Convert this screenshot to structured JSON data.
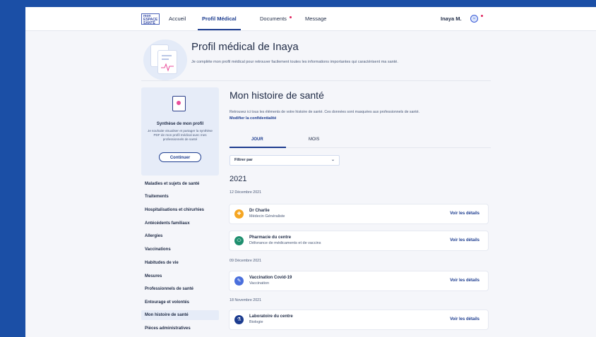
{
  "topbar": {
    "logo": "mon ESPACE SANTÉ",
    "nav": [
      {
        "label": "Accueil",
        "active": false
      },
      {
        "label": "Profil Médical",
        "active": true
      },
      {
        "label": "Documents",
        "active": false,
        "notify": true
      },
      {
        "label": "Message",
        "active": false
      }
    ],
    "user_name": "Inaya M.",
    "avatar_text": "☺"
  },
  "header": {
    "title": "Profil médical de Inaya",
    "subtitle": "Je complète mon profil médical pour retrouver facilement toutes les informations importantes qui caractérisent ma santé."
  },
  "synthesis": {
    "title": "Synthèse de mon profil",
    "text": "Je souhaite visualiser et partager la synthèse PDF de mon profil médical avec mes professionnels de santé",
    "button": "Continuer"
  },
  "sidebar": {
    "items": [
      {
        "label": "Maladies et sujets de santé"
      },
      {
        "label": "Traitements"
      },
      {
        "label": "Hospitalisations et chirurhies"
      },
      {
        "label": "Antécédents familiaux"
      },
      {
        "label": "Allergies"
      },
      {
        "label": "Vaccinations"
      },
      {
        "label": "Habitudes de vie"
      },
      {
        "label": "Mesures"
      },
      {
        "label": "Professionnels de santé"
      },
      {
        "label": "Entourage et volontés"
      },
      {
        "label": "Mon histoire de santé",
        "active": true
      },
      {
        "label": "Pièces administratives"
      }
    ]
  },
  "history": {
    "title": "Mon histoire de santé",
    "description": "Retrouvez ici tous les éléments de votre histoire de santé. Ces données sont masquées aux professionnels de santé.",
    "privacy_link": "Modifier la confidentialité",
    "tabs": [
      "JOUR",
      "MOIS"
    ],
    "filter_label": "Filtrer par",
    "year": "2021",
    "groups": [
      {
        "date": "12 Décembre 2021",
        "events": [
          {
            "name": "Dr Charlie",
            "sub": "Médecin Généraliste",
            "link": "Voir les détails",
            "icon": "doctor-icon",
            "color": "#f5a623"
          },
          {
            "name": "Pharmacie du centre",
            "sub": "Délivrance de médicaments et de vaccins",
            "link": "Voir les détails",
            "icon": "pill-icon",
            "color": "#1e8f6e"
          }
        ]
      },
      {
        "date": "09 Décembre 2021",
        "events": [
          {
            "name": "Vaccination Covid-19",
            "sub": "Vaccination",
            "link": "Voir les détails",
            "icon": "syringe-icon",
            "color": "#4a6fdc"
          }
        ]
      },
      {
        "date": "18 Novembre 2021",
        "events": [
          {
            "name": "Laboratoire du centre",
            "sub": "Biologie",
            "link": "Voir les détails",
            "icon": "flask-icon",
            "color": "#1c3c8f"
          }
        ]
      }
    ]
  }
}
